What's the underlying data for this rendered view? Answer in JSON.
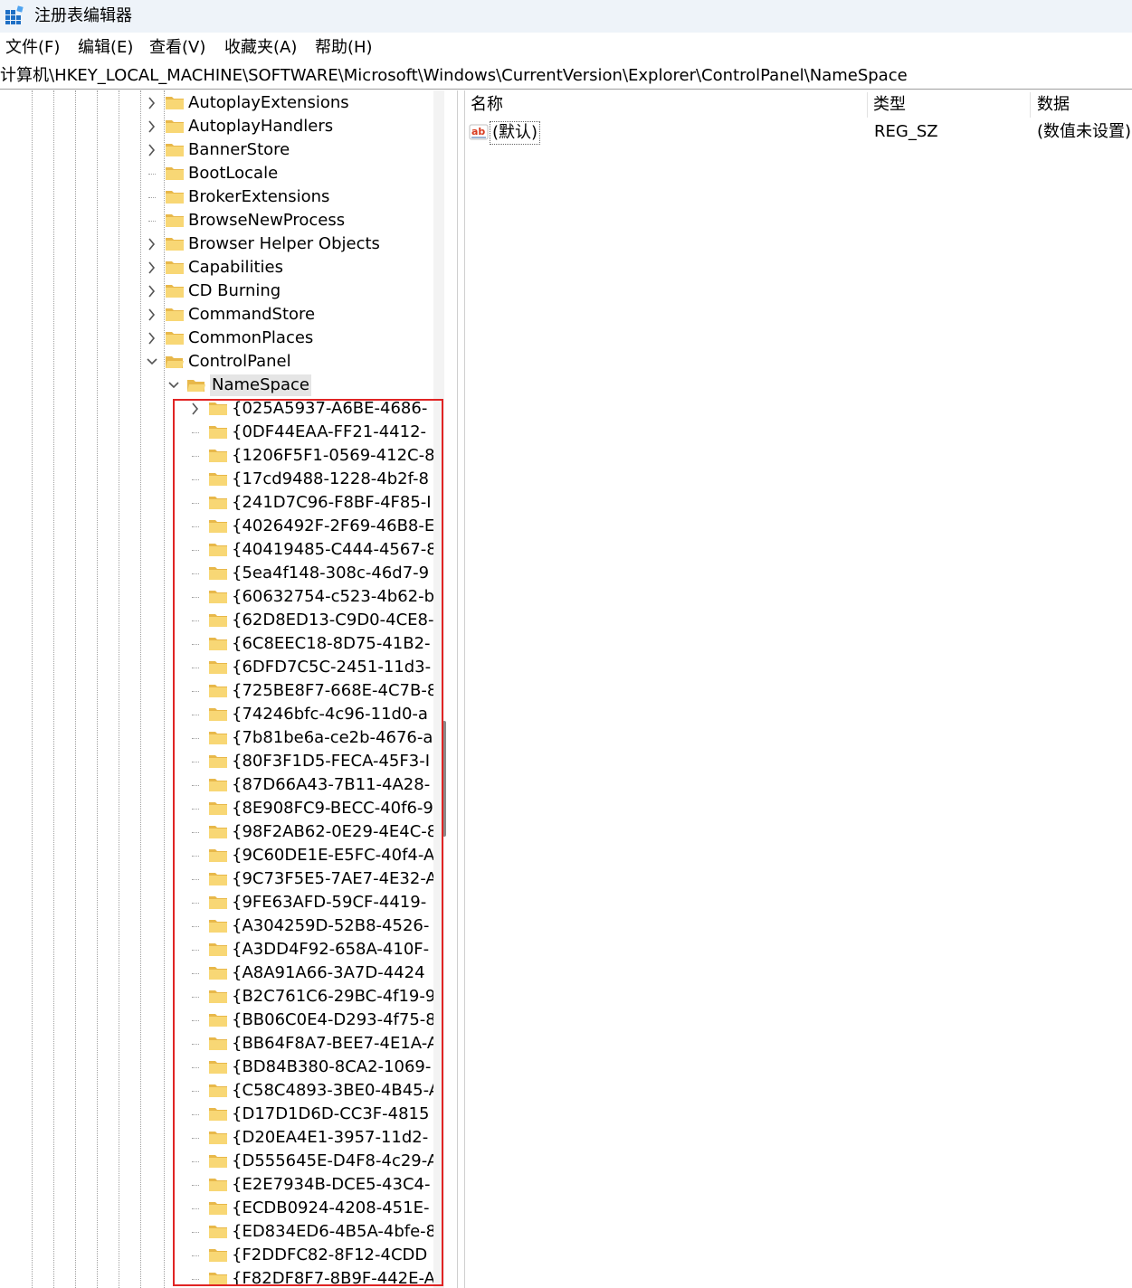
{
  "window": {
    "title": "注册表编辑器",
    "accent_color": "#1e6fc5"
  },
  "menu": [
    {
      "label": "文件(F)"
    },
    {
      "label": "编辑(E)"
    },
    {
      "label": "查看(V)"
    },
    {
      "label": "收藏夹(A)"
    },
    {
      "label": "帮助(H)"
    }
  ],
  "address": {
    "path": "计算机\\HKEY_LOCAL_MACHINE\\SOFTWARE\\Microsoft\\Windows\\CurrentVersion\\Explorer\\ControlPanel\\NameSpace"
  },
  "tree": {
    "siblings": [
      {
        "label": "AutoplayExtensions",
        "expander": "collapsed"
      },
      {
        "label": "AutoplayHandlers",
        "expander": "collapsed"
      },
      {
        "label": "BannerStore",
        "expander": "collapsed"
      },
      {
        "label": "BootLocale",
        "expander": "none"
      },
      {
        "label": "BrokerExtensions",
        "expander": "none"
      },
      {
        "label": "BrowseNewProcess",
        "expander": "none"
      },
      {
        "label": "Browser Helper Objects",
        "expander": "collapsed"
      },
      {
        "label": "Capabilities",
        "expander": "collapsed"
      },
      {
        "label": "CD Burning",
        "expander": "collapsed"
      },
      {
        "label": "CommandStore",
        "expander": "collapsed"
      },
      {
        "label": "CommonPlaces",
        "expander": "collapsed"
      },
      {
        "label": "ControlPanel",
        "expander": "expanded"
      }
    ],
    "selected": {
      "label": "NameSpace",
      "expander": "expanded"
    },
    "children": [
      {
        "label": "{025A5937-A6BE-4686-",
        "expander": "collapsed"
      },
      {
        "label": "{0DF44EAA-FF21-4412-",
        "expander": "none"
      },
      {
        "label": "{1206F5F1-0569-412C-8",
        "expander": "none"
      },
      {
        "label": "{17cd9488-1228-4b2f-8",
        "expander": "none"
      },
      {
        "label": "{241D7C96-F8BF-4F85-I",
        "expander": "none"
      },
      {
        "label": "{4026492F-2F69-46B8-E",
        "expander": "none"
      },
      {
        "label": "{40419485-C444-4567-8",
        "expander": "none"
      },
      {
        "label": "{5ea4f148-308c-46d7-9",
        "expander": "none"
      },
      {
        "label": "{60632754-c523-4b62-b",
        "expander": "none"
      },
      {
        "label": "{62D8ED13-C9D0-4CE8-",
        "expander": "none"
      },
      {
        "label": "{6C8EEC18-8D75-41B2-",
        "expander": "none"
      },
      {
        "label": "{6DFD7C5C-2451-11d3-",
        "expander": "none"
      },
      {
        "label": "{725BE8F7-668E-4C7B-8",
        "expander": "none"
      },
      {
        "label": "{74246bfc-4c96-11d0-a",
        "expander": "none"
      },
      {
        "label": "{7b81be6a-ce2b-4676-a",
        "expander": "none"
      },
      {
        "label": "{80F3F1D5-FECA-45F3-I",
        "expander": "none"
      },
      {
        "label": "{87D66A43-7B11-4A28-",
        "expander": "none"
      },
      {
        "label": "{8E908FC9-BECC-40f6-9",
        "expander": "none"
      },
      {
        "label": "{98F2AB62-0E29-4E4C-8",
        "expander": "none"
      },
      {
        "label": "{9C60DE1E-E5FC-40f4-A",
        "expander": "none"
      },
      {
        "label": "{9C73F5E5-7AE7-4E32-A",
        "expander": "none"
      },
      {
        "label": "{9FE63AFD-59CF-4419-",
        "expander": "none"
      },
      {
        "label": "{A304259D-52B8-4526-",
        "expander": "none"
      },
      {
        "label": "{A3DD4F92-658A-410F-",
        "expander": "none"
      },
      {
        "label": "{A8A91A66-3A7D-4424",
        "expander": "none"
      },
      {
        "label": "{B2C761C6-29BC-4f19-9",
        "expander": "none"
      },
      {
        "label": "{BB06C0E4-D293-4f75-8",
        "expander": "none"
      },
      {
        "label": "{BB64F8A7-BEE7-4E1A-A",
        "expander": "none"
      },
      {
        "label": "{BD84B380-8CA2-1069-",
        "expander": "none"
      },
      {
        "label": "{C58C4893-3BE0-4B45-A",
        "expander": "none"
      },
      {
        "label": "{D17D1D6D-CC3F-4815",
        "expander": "none"
      },
      {
        "label": "{D20EA4E1-3957-11d2-",
        "expander": "none"
      },
      {
        "label": "{D555645E-D4F8-4c29-A",
        "expander": "none"
      },
      {
        "label": "{E2E7934B-DCE5-43C4-",
        "expander": "none"
      },
      {
        "label": "{ECDB0924-4208-451E-",
        "expander": "none"
      },
      {
        "label": "{ED834ED6-4B5A-4bfe-8",
        "expander": "none"
      },
      {
        "label": "{F2DDFC82-8F12-4CDD",
        "expander": "none"
      },
      {
        "label": "{F82DF8F7-8B9F-442E-A",
        "expander": "none"
      }
    ],
    "highlight_color": "#e02424"
  },
  "values": {
    "columns": {
      "name": "名称",
      "type": "类型",
      "data": "数据"
    },
    "rows": [
      {
        "name": "(默认)",
        "type": "REG_SZ",
        "data": "(数值未设置)",
        "icon": "string-value-icon"
      }
    ]
  },
  "icons": {
    "folder": "folder-icon",
    "folder_open": "folder-open-icon",
    "app": "registry-editor-icon"
  },
  "colors": {
    "folder_fill": "#f8d775",
    "folder_dark": "#e8b84a",
    "selected_bg": "#e5e5e5"
  }
}
